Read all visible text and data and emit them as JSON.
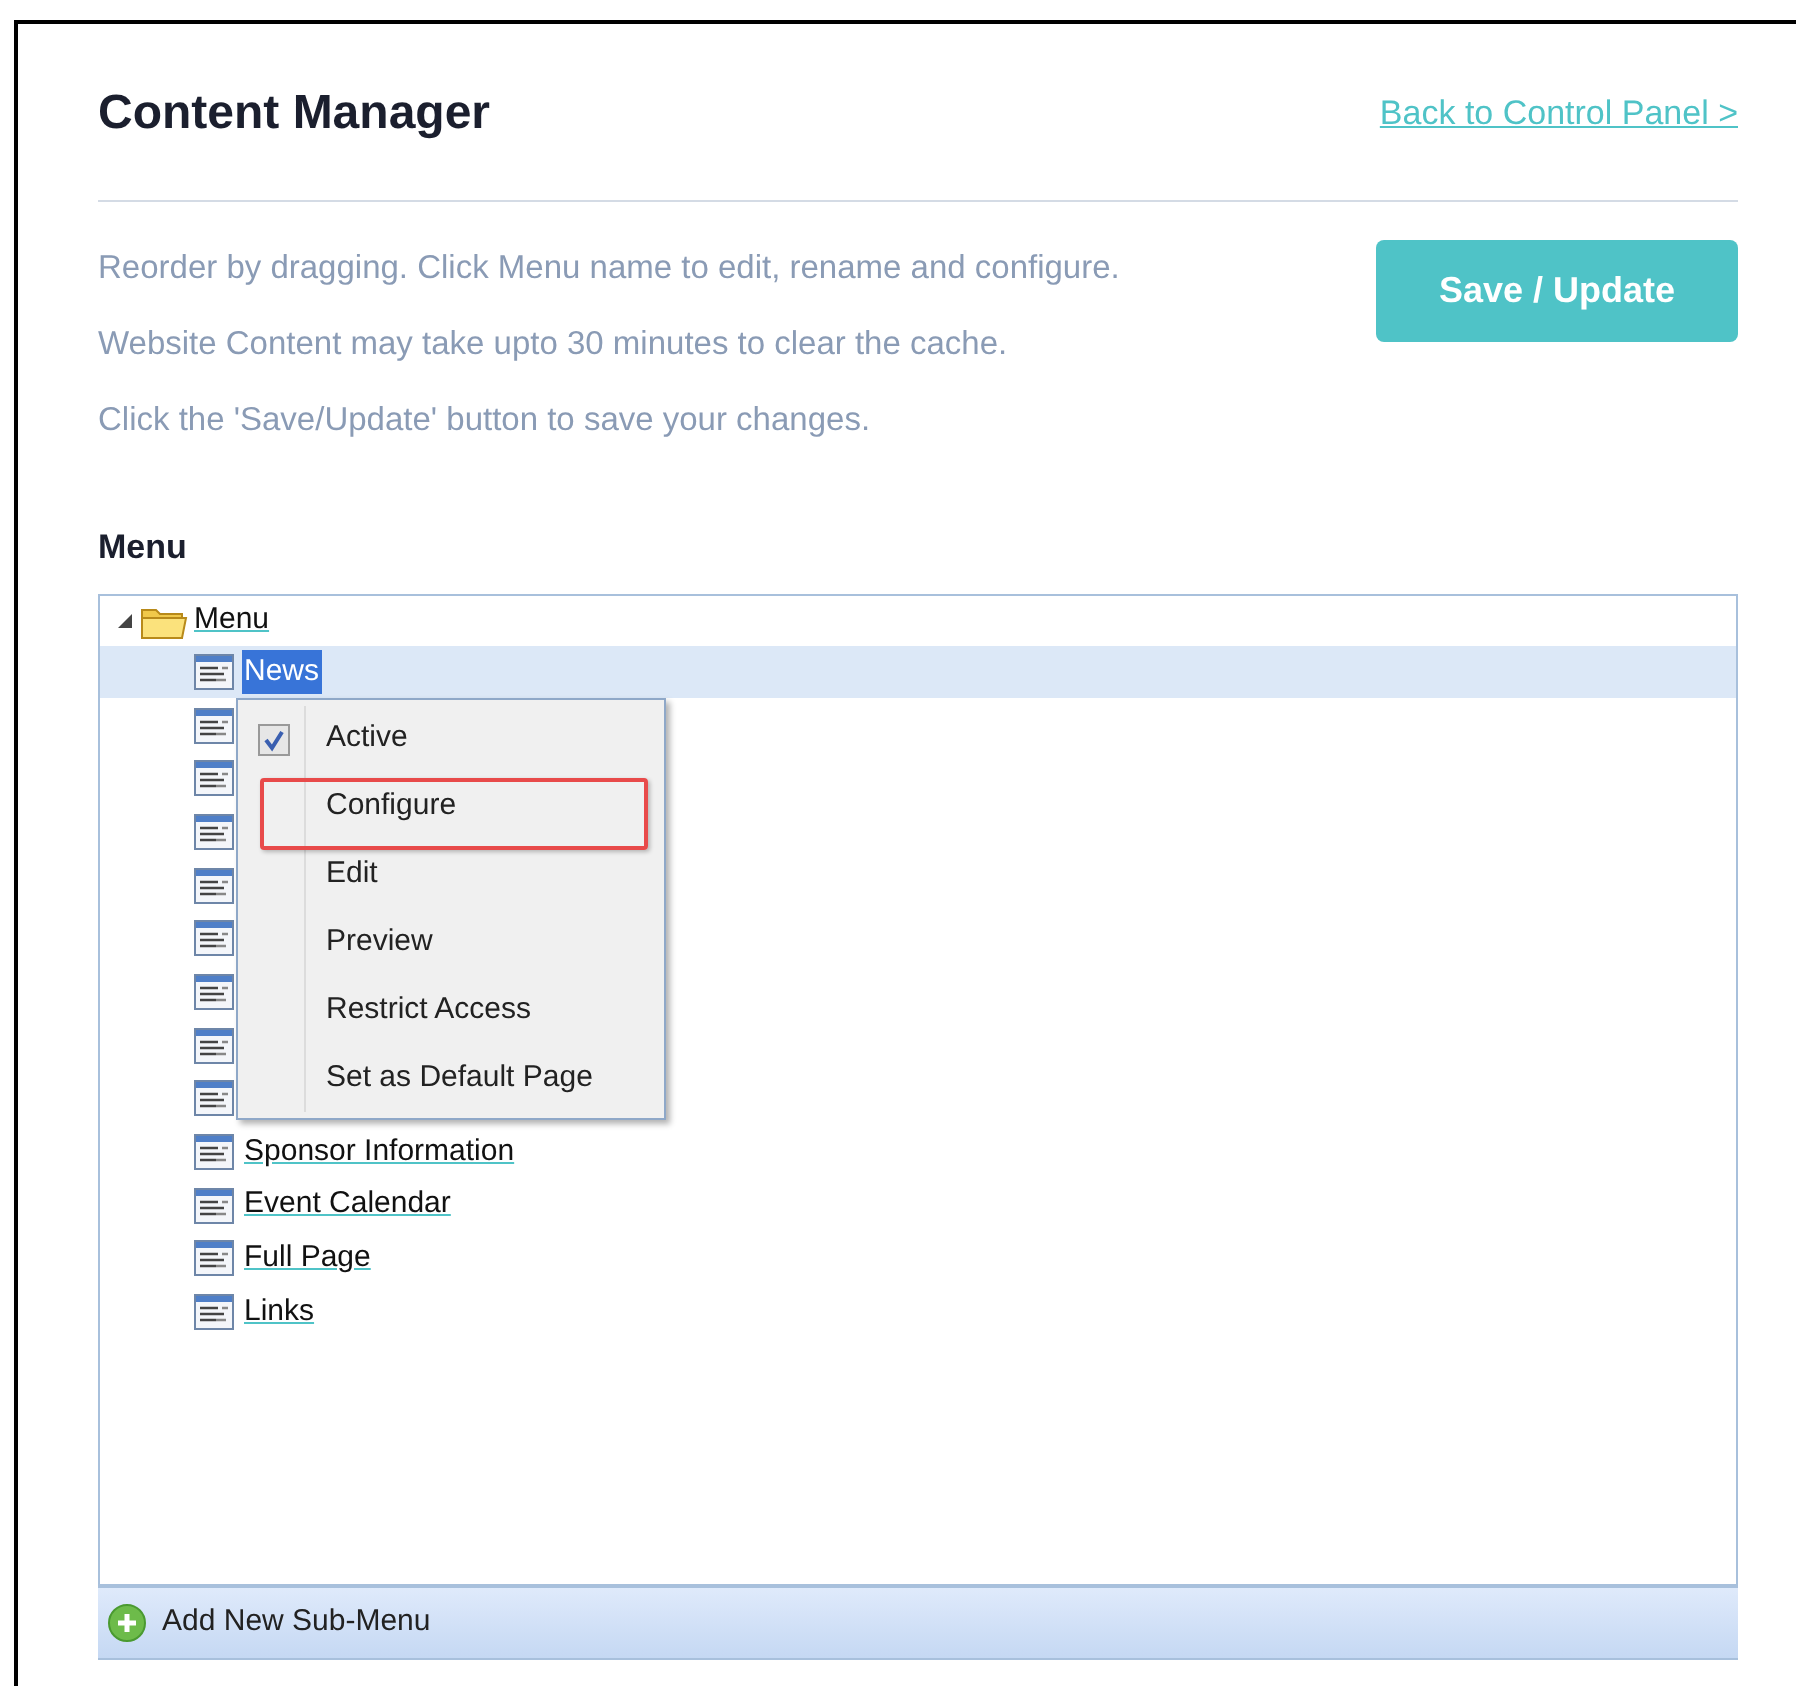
{
  "header": {
    "title": "Content Manager",
    "back_link": "Back to Control Panel >"
  },
  "instructions": [
    "Reorder by dragging. Click Menu name to edit, rename and configure.",
    "Website Content may take upto 30 minutes to clear the cache.",
    "Click the 'Save/Update' button to save your changes."
  ],
  "save_button": "Save / Update",
  "menu_heading": "Menu",
  "tree": {
    "label": "Menu",
    "expanded": true,
    "children": [
      {
        "label": "News",
        "selected": true
      },
      {
        "selected": false
      },
      {
        "selected": false
      },
      {
        "selected": false
      },
      {
        "selected": false
      },
      {
        "selected": false
      },
      {
        "selected": false
      },
      {
        "selected": false
      },
      {
        "selected": false
      },
      {
        "label": "Sponsor Information",
        "selected": false
      },
      {
        "label": "Event Calendar",
        "selected": false
      },
      {
        "label": "Full Page",
        "selected": false
      },
      {
        "label": "Links",
        "selected": false
      }
    ]
  },
  "context_menu": [
    {
      "label": "Active",
      "kind": "checkbox",
      "checked": true,
      "highlighted": false
    },
    {
      "label": "Configure",
      "kind": "action",
      "highlighted": true
    },
    {
      "label": "Edit",
      "kind": "action",
      "highlighted": false
    },
    {
      "label": "Preview",
      "kind": "action",
      "highlighted": false
    },
    {
      "label": "Restrict Access",
      "kind": "action",
      "highlighted": false
    },
    {
      "label": "Set as Default Page",
      "kind": "action",
      "highlighted": false
    }
  ],
  "add_button": "Add New Sub-Menu"
}
